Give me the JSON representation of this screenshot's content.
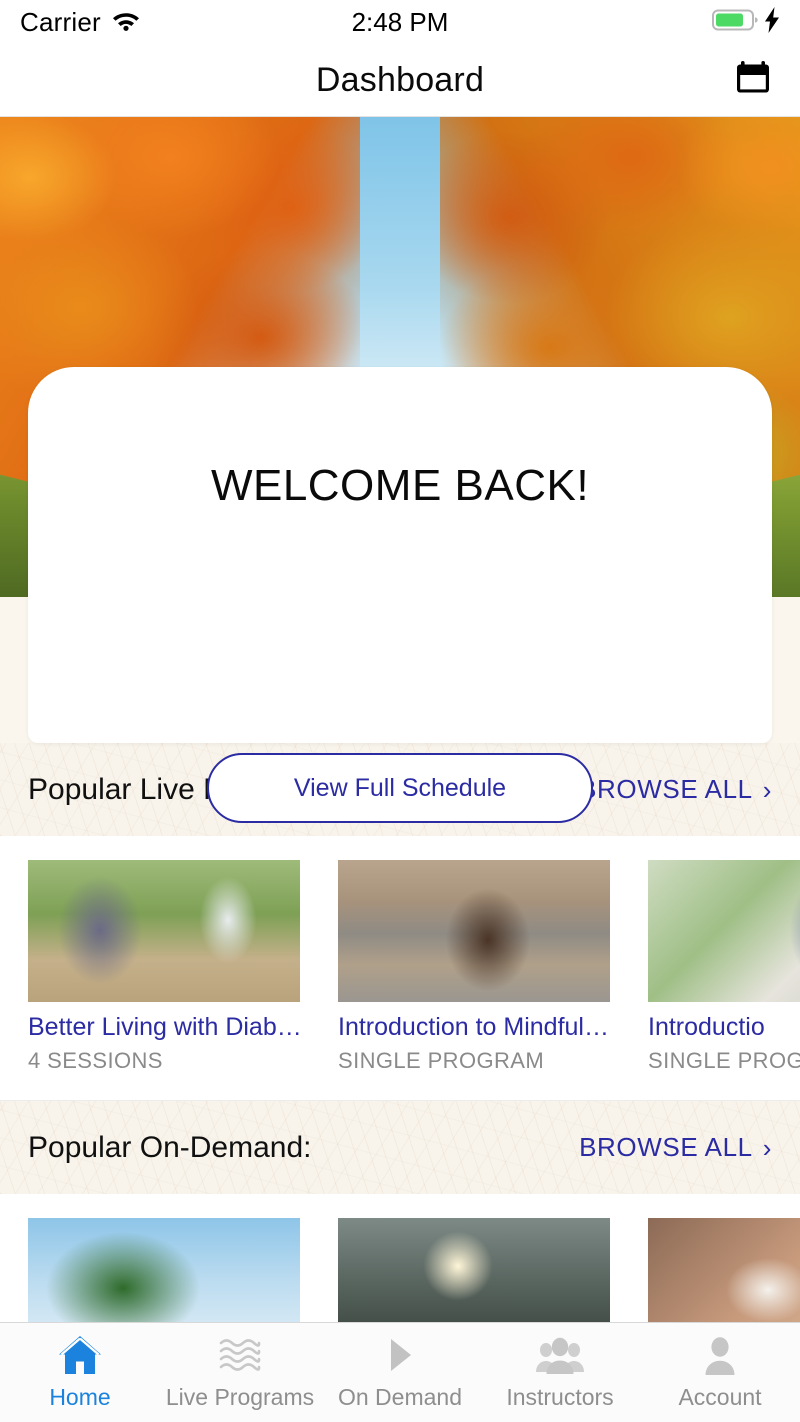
{
  "status_bar": {
    "carrier": "Carrier",
    "wifi_icon": "wifi-icon",
    "time": "2:48 PM",
    "battery_icon": "battery-icon",
    "charging_icon": "lightning-bolt-icon",
    "battery_color": "#4cd964"
  },
  "nav_bar": {
    "title": "Dashboard",
    "action_icon": "calendar-icon"
  },
  "hero": {
    "image_description": "autumn-canal-trees-photo"
  },
  "welcome": {
    "title": "WELCOME BACK!",
    "button_label": "View Full Schedule",
    "accent_color": "#2b2ba3"
  },
  "sections": [
    {
      "title": "Popular Live Programs:",
      "browse_label": "BROWSE ALL",
      "chevron": "›",
      "cards": [
        {
          "title": "Better Living with Diab…",
          "subtitle": "4 SESSIONS",
          "thumb": "t-walk"
        },
        {
          "title": "Introduction to Mindful…",
          "subtitle": "SINGLE PROGRAM",
          "thumb": "t-mind"
        },
        {
          "title": "Introductio",
          "subtitle": "SINGLE PROG",
          "thumb": "t-breathe"
        }
      ]
    },
    {
      "title": "Popular On-Demand:",
      "browse_label": "BROWSE ALL",
      "chevron": "›",
      "cards": [
        {
          "title": "",
          "subtitle": "",
          "thumb": "t-tree"
        },
        {
          "title": "",
          "subtitle": "",
          "thumb": "t-forest"
        },
        {
          "title": "",
          "subtitle": "",
          "thumb": "t-hands"
        }
      ]
    }
  ],
  "tab_bar": {
    "active_color": "#1b83dd",
    "inactive_color": "#8e8e8e",
    "items": [
      {
        "label": "Home",
        "icon": "home-icon",
        "active": true
      },
      {
        "label": "Live Programs",
        "icon": "waves-icon",
        "active": false
      },
      {
        "label": "On Demand",
        "icon": "play-icon",
        "active": false
      },
      {
        "label": "Instructors",
        "icon": "people-group-icon",
        "active": false
      },
      {
        "label": "Account",
        "icon": "person-icon",
        "active": false
      }
    ]
  }
}
